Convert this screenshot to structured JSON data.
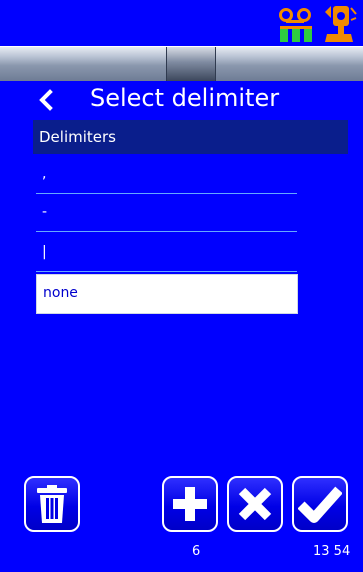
{
  "header": {
    "title": "Select delimiter"
  },
  "list": {
    "header": "Delimiters",
    "items": [
      {
        "label": ","
      },
      {
        "label": "-"
      },
      {
        "label": "|"
      },
      {
        "label": "none",
        "selected": true
      }
    ]
  },
  "footer": {
    "count": "6",
    "time": "13 54"
  },
  "icons": {
    "status": [
      "network-icon",
      "alarm-icon"
    ],
    "back": "chevron-left-icon",
    "delete": "trash-icon",
    "add": "plus-icon",
    "cancel": "close-icon",
    "confirm": "check-icon"
  },
  "colors": {
    "background": "#0000ff",
    "list_header_bg": "#0a1e8c",
    "selected_bg": "#ffffff",
    "accent_orange": "#f08a00",
    "network_green": "#2ecc40"
  }
}
